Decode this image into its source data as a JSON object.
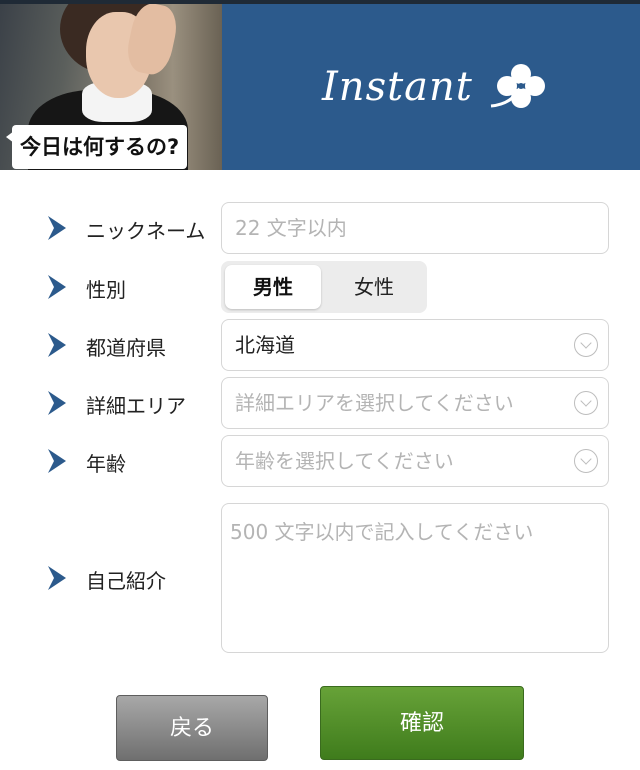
{
  "banner": {
    "speech_bubble": "今日は何するの?",
    "logo_text": "Instant",
    "colors": {
      "background": "#2c5a8c",
      "logo": "#ffffff"
    }
  },
  "form": {
    "nickname": {
      "label": "ニックネーム",
      "placeholder": "22 文字以内"
    },
    "gender": {
      "label": "性別",
      "options": [
        "男性",
        "女性"
      ],
      "selected": "男性"
    },
    "prefecture": {
      "label": "都道府県",
      "value": "北海道"
    },
    "area": {
      "label": "詳細エリア",
      "placeholder": "詳細エリアを選択してください"
    },
    "age": {
      "label": "年齢",
      "placeholder": "年齢を選択してください"
    },
    "intro": {
      "label": "自己紹介",
      "placeholder": "500 文字以内で記入してください"
    }
  },
  "buttons": {
    "back": "戻る",
    "confirm": "確認",
    "colors": {
      "back": "#8a8a8a",
      "confirm": "#4f8c28"
    }
  },
  "colors": {
    "arrow": "#2c5a8c",
    "placeholder": "#b4b4b4"
  }
}
